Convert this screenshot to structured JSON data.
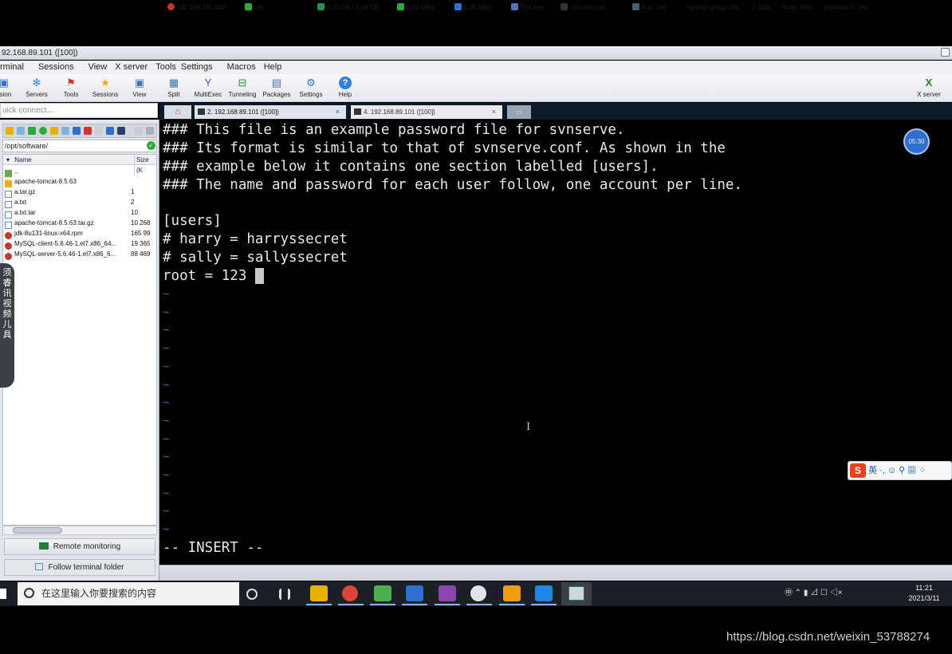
{
  "window": {
    "title": "92.168.89.101 ([100])"
  },
  "menu": [
    "rminal",
    "Sessions",
    "View",
    "X server",
    "Tools",
    "Settings",
    "Macros",
    "Help"
  ],
  "toolbar": {
    "buttons": [
      {
        "label": "ssion",
        "icon": "session-icon"
      },
      {
        "label": "Servers",
        "icon": "servers-icon"
      },
      {
        "label": "Tools",
        "icon": "tools-icon"
      },
      {
        "label": "Sessions",
        "icon": "sessions-icon"
      },
      {
        "label": "View",
        "icon": "view-icon"
      },
      {
        "label": "Split",
        "icon": "split-icon"
      },
      {
        "label": "MultiExec",
        "icon": "multiexec-icon"
      },
      {
        "label": "Tunneling",
        "icon": "tunneling-icon"
      },
      {
        "label": "Packages",
        "icon": "packages-icon"
      },
      {
        "label": "Settings",
        "icon": "settings-icon"
      },
      {
        "label": "Help",
        "icon": "help-icon"
      }
    ],
    "xserver_label": "X server"
  },
  "quick_connect": {
    "placeholder": "uick connect..."
  },
  "tabs": [
    {
      "label": "2. 192.168.89.101 ([100])",
      "close": "×"
    },
    {
      "label": "4. 192.168.89.101 ([100])",
      "close": "×"
    }
  ],
  "sftp": {
    "path": "/opt/software/",
    "columns": {
      "name": "Name",
      "size": "Size (K"
    },
    "files": [
      {
        "name": "..",
        "size": "",
        "type": "parent"
      },
      {
        "name": "apache-tomcat-8.5.63",
        "size": "",
        "type": "folder"
      },
      {
        "name": "a.tar.gz",
        "size": "1",
        "type": "file"
      },
      {
        "name": "a.txt",
        "size": "2",
        "type": "file"
      },
      {
        "name": "a.txt.tar",
        "size": "10",
        "type": "file"
      },
      {
        "name": "apache-tomcat-8.5.63.tar.gz",
        "size": "10 268",
        "type": "file"
      },
      {
        "name": "jdk-8u131-linux-x64.rpm",
        "size": "165 99",
        "type": "rpm"
      },
      {
        "name": "MySQL-client-5.6.46-1.el7.x86_64...",
        "size": "19 365",
        "type": "rpm"
      },
      {
        "name": "MySQL-server-5.6.46-1.el7.x86_6...",
        "size": "88 469",
        "type": "rpm"
      }
    ],
    "remote_monitoring": "Remote monitoring",
    "follow_terminal": "Follow terminal folder",
    "side_badge": "须 睿 讯 视 频 儿 具"
  },
  "terminal": {
    "lines": [
      "### This file is an example password file for svnserve.",
      "### Its format is similar to that of svnserve.conf. As shown in the",
      "### example below it contains one section labelled [users].",
      "### The name and password for each user follow, one account per line.",
      "",
      "[users]",
      "# harry = harryssecret",
      "# sally = sallyssecret",
      "root = 123"
    ],
    "tilde": "~",
    "tilde_count": 14,
    "mode": "-- INSERT --",
    "bubble_time": "05:30"
  },
  "ime": {
    "logo": "S",
    "text": "英 ·, ☺ ⚲ ▦ ⁘"
  },
  "statusbar": [
    {
      "text": "192.168.145.180",
      "icon": "server-icon",
      "color": "#c0392b"
    },
    {
      "text": "1%",
      "icon": "cpu-icon",
      "color": "#2eaa3d"
    },
    {
      "text": "",
      "icon": "black-box",
      "color": "#000000"
    },
    {
      "text": "0.35 GB / 3.68 GB",
      "icon": "memory-icon",
      "color": "#2e8b57"
    },
    {
      "text": "0.01 Mb/s",
      "icon": "upload-icon",
      "color": "#2eaa3d"
    },
    {
      "text": "0.00 Mb/s",
      "icon": "download-icon",
      "color": "#2f6fcf"
    },
    {
      "text": "154 min",
      "icon": "uptime-icon",
      "color": "#4a77b4"
    },
    {
      "text": "root  root  root",
      "icon": "user-icon",
      "color": "#333333"
    },
    {
      "text": "/run: 1%",
      "icon": "disk-icon",
      "color": "#4a5a70"
    },
    {
      "text": "/sys/fs/cgroup: 0%",
      "icon": "",
      "color": ""
    },
    {
      "text": "/: 10%",
      "icon": "",
      "color": ""
    },
    {
      "text": "/boot: 15%",
      "icon": "",
      "color": ""
    },
    {
      "text": "/run/user/0: 0%",
      "icon": "",
      "color": ""
    }
  ],
  "taskbar": {
    "search_placeholder": "在这里输入你要搜索的内容",
    "apps": [
      "task-view-icon",
      "widgets-icon",
      "explorer-icon",
      "chrome-icon",
      "notepad-icon",
      "remote-desktop-icon",
      "intellij-icon",
      "navicat-icon",
      "vmware-icon",
      "wps-icon",
      "mobaxterm-icon"
    ],
    "tray_text": "㊥ ⌃ ▮ ⊿ ☐ ◁×",
    "time": "11:21",
    "date": "2021/3/11"
  },
  "watermark": "https://blog.csdn.net/weixin_53788274"
}
